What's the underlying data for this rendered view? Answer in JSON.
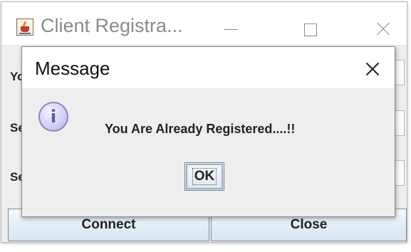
{
  "window": {
    "title": "Client Registra...",
    "controls": {
      "minimize_icon": "minimize-icon",
      "maximize_icon": "maximize-icon",
      "close_icon": "close-icon"
    }
  },
  "form": {
    "labels": [
      "Yo",
      "Se",
      "Se"
    ],
    "connect_label": "Connect",
    "close_label": "Close"
  },
  "dialog": {
    "title": "Message",
    "icon": "info-icon",
    "icon_glyph": "i",
    "message": "You Are Already Registered....!!",
    "ok_label": "OK"
  }
}
